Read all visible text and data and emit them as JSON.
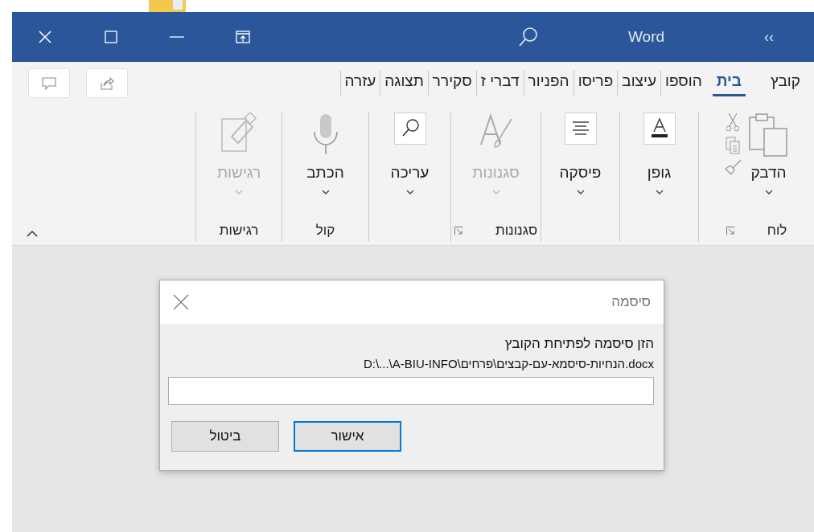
{
  "titlebar": {
    "title": "Word",
    "collapse_glyph": "‹‹"
  },
  "tabs": [
    {
      "label": "קובץ",
      "selected": false
    },
    {
      "label": "בית",
      "selected": true
    },
    {
      "label": "הוספו",
      "selected": false
    },
    {
      "label": "עיצוב",
      "selected": false
    },
    {
      "label": "פריסו",
      "selected": false
    },
    {
      "label": "הפניור",
      "selected": false
    },
    {
      "label": "דברי ז",
      "selected": false
    },
    {
      "label": "סקירר",
      "selected": false
    },
    {
      "label": "תצוגה",
      "selected": false
    },
    {
      "label": "עזרה",
      "selected": false
    }
  ],
  "ribbon": {
    "groups": [
      {
        "label": "לוח",
        "launcher": true,
        "commands": [
          {
            "kind": "large",
            "label": "הדבק",
            "disabled": false
          },
          {
            "kind": "small"
          },
          {
            "kind": "small"
          },
          {
            "kind": "small"
          }
        ]
      },
      {
        "commands": [
          {
            "kind": "large",
            "label": "גופן",
            "disabled": false
          }
        ]
      },
      {
        "commands": [
          {
            "kind": "large",
            "label": "פיסקה",
            "disabled": false
          }
        ]
      },
      {
        "label": "סגנונות",
        "launcher": true,
        "commands": [
          {
            "kind": "large",
            "label": "סגנונות",
            "disabled": true
          }
        ]
      },
      {
        "commands": [
          {
            "kind": "large",
            "label": "עריכה",
            "disabled": false
          }
        ]
      },
      {
        "label": "קול",
        "commands": [
          {
            "kind": "large",
            "label": "הכתב",
            "disabled": false
          }
        ]
      },
      {
        "label": "רגישות",
        "commands": [
          {
            "kind": "large",
            "label": "רגישות",
            "disabled": true
          }
        ]
      }
    ]
  },
  "dialog": {
    "title": "סיסמה",
    "prompt": "הזן סיסמה לפתיחת הקובץ",
    "path": "D:\\...\\A-BIU-INFO\\הנחיות-סיסמא-עם-קבצים\\פרחים.docx",
    "buttons": [
      {
        "label": "אישור",
        "default": true
      },
      {
        "label": "ביטול",
        "default": false
      }
    ]
  }
}
